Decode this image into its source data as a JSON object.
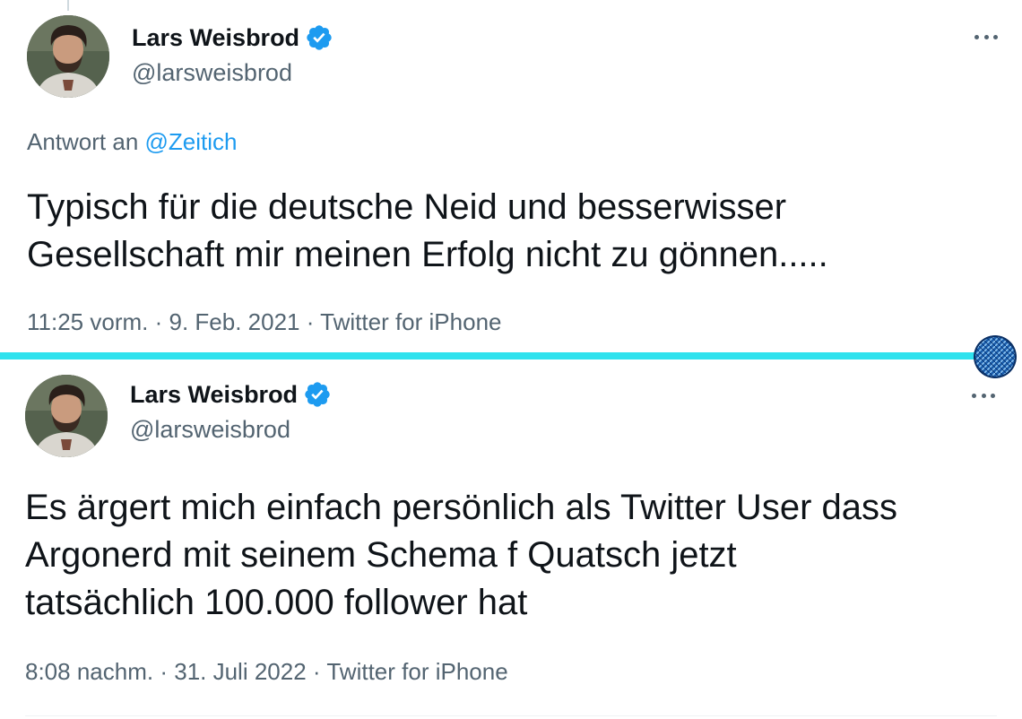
{
  "tweets": [
    {
      "display_name": "Lars Weisbrod",
      "handle": "@larsweisbrod",
      "reply_to_prefix": "Antwort an",
      "reply_to_mention": "@Zeitich",
      "text": "Typisch für die deutsche Neid und besserwisser\nGesellschaft mir meinen Erfolg nicht zu gönnen.....",
      "time": "11:25 vorm.",
      "date": "9. Feb. 2021",
      "source": "Twitter for iPhone",
      "separator": "·",
      "verified": true
    },
    {
      "display_name": "Lars Weisbrod",
      "handle": "@larsweisbrod",
      "text": "Es ärgert mich einfach persönlich als Twitter User dass\nArgonerd mit seinem Schema f Quatsch jetzt\ntatsächlich 100.000 follower hat",
      "time": "8:08 nachm.",
      "date": "31. Juli 2022",
      "source": "Twitter for iPhone",
      "separator": "·",
      "verified": true
    }
  ],
  "icons": {
    "verified": "verified-badge-icon",
    "more": "more-options-icon"
  },
  "colors": {
    "verified_blue": "#1d9bf0",
    "divider_cyan": "#2fe2ee",
    "secondary_text": "#536471",
    "primary_text": "#0f1419"
  }
}
